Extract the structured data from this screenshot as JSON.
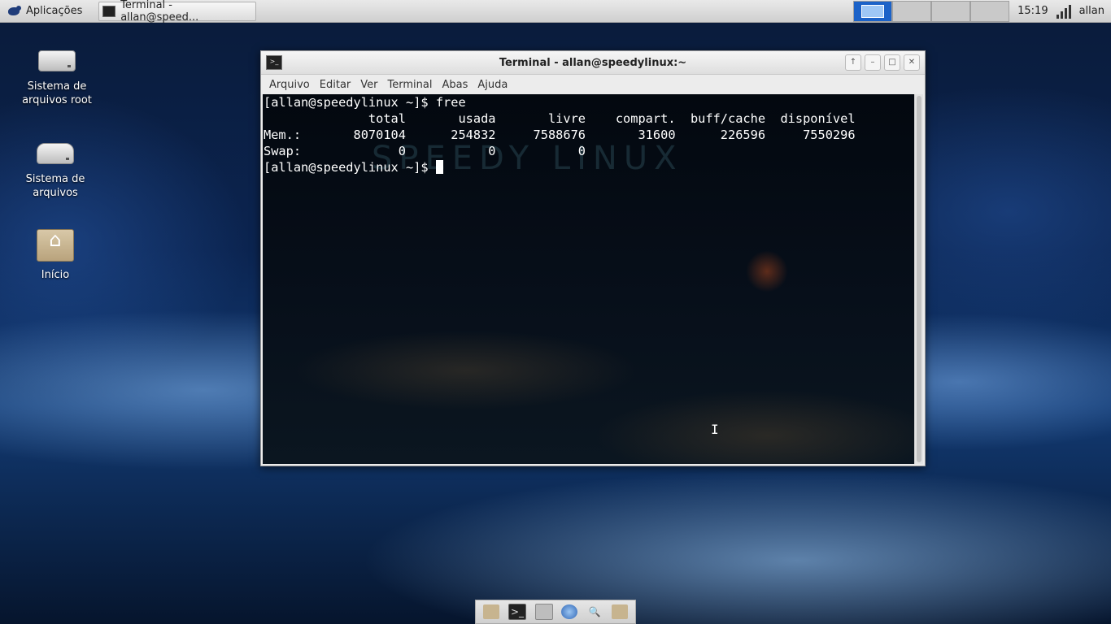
{
  "top_panel": {
    "apps_label": "Aplicações",
    "task_label": "Terminal - allan@speed...",
    "clock": "15:19",
    "user": "allan"
  },
  "desktop_icons": [
    {
      "label": "Sistema de arquivos root",
      "icon": "drive-icon"
    },
    {
      "label": "Sistema de arquivos",
      "icon": "drive-icon"
    },
    {
      "label": "Início",
      "icon": "home-folder-icon"
    }
  ],
  "window": {
    "title": "Terminal - allan@speedylinux:~",
    "menu": [
      "Arquivo",
      "Editar",
      "Ver",
      "Terminal",
      "Abas",
      "Ajuda"
    ],
    "watermark": "SPEEDY LINUX",
    "terminal_lines": [
      "[allan@speedylinux ~]$ free",
      "              total       usada       livre    compart.  buff/cache  disponível",
      "Mem.:       8070104      254832     7588676       31600      226596     7550296",
      "Swap:             0           0           0"
    ],
    "prompt": "[allan@speedylinux ~]$ "
  },
  "dock": {
    "icons": [
      "folder-icon",
      "terminal-icon",
      "file-manager-icon",
      "browser-icon",
      "search-icon",
      "folder-icon"
    ]
  },
  "colors": {
    "terminal_bg": "#050b14",
    "terminal_fg": "#ffffff",
    "active_workspace": "#1b62c8"
  }
}
